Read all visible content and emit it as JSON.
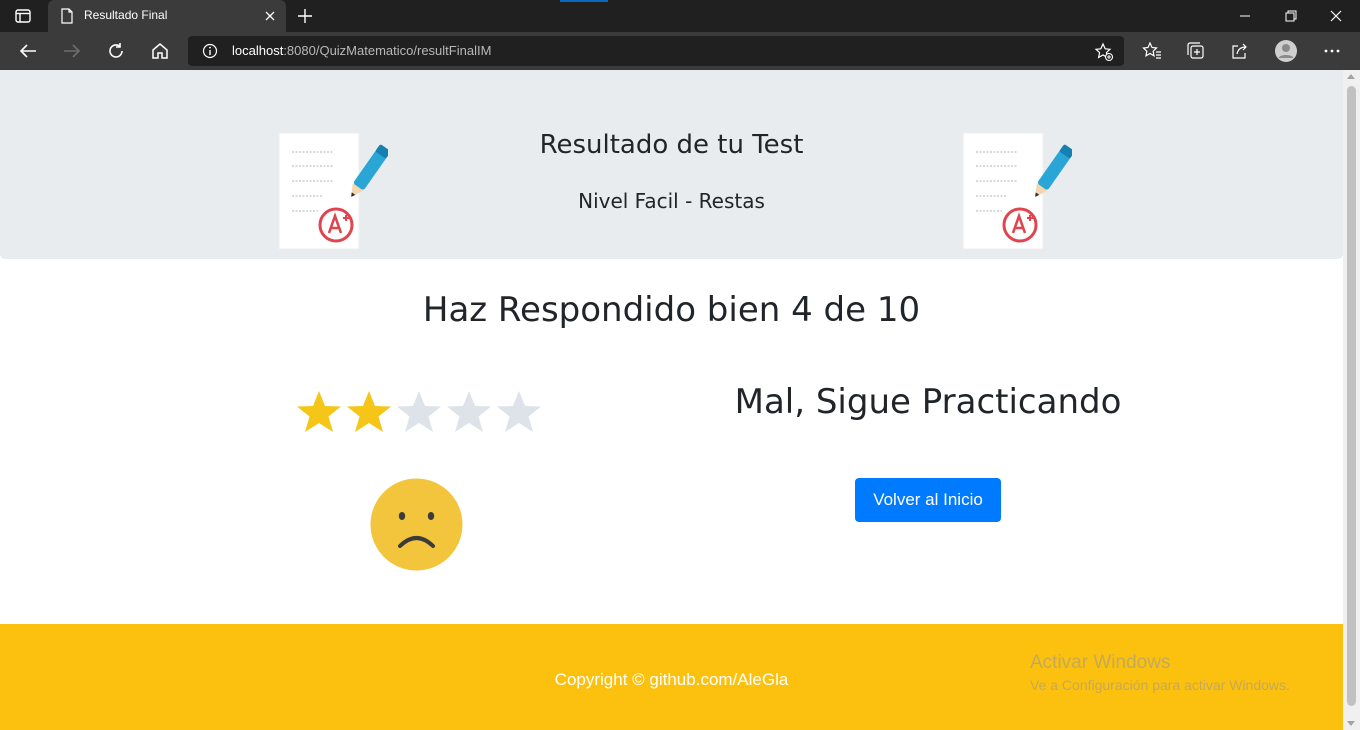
{
  "browser": {
    "tab_title": "Resultado Final",
    "url_host": "localhost",
    "url_rest": ":8080/QuizMatematico/resultFinalIM",
    "icons": [
      "sidebar-icon",
      "page-icon",
      "close-icon",
      "plus-icon",
      "minimize-icon",
      "maximize-icon",
      "close-window-icon",
      "back-icon",
      "forward-icon",
      "refresh-icon",
      "home-icon",
      "info-icon",
      "add-favorite-icon",
      "favorites-icon",
      "collections-icon",
      "share-icon",
      "profile-icon",
      "more-icon"
    ]
  },
  "header": {
    "title": "Resultado de tu Test",
    "subtitle": "Nivel Facil - Restas",
    "background": "#e9ecef"
  },
  "result": {
    "score_text": "Haz Respondido bien 4 de 10",
    "rating": {
      "filled": 2,
      "total": 5
    },
    "star_color": "#f5c518",
    "star_empty_color": "#dde3e9",
    "face_icon": "sad-face-icon",
    "verdict": "Mal, Sigue Practicando"
  },
  "actions": {
    "home_button_label": "Volver al Inicio",
    "button_color": "#007bff"
  },
  "footer": {
    "copyright": "Copyright © github.com/AleGla",
    "background": "#fcc10f"
  },
  "os_watermark": {
    "title": "Activar Windows",
    "subtitle": "Ve a Configuración para activar Windows."
  }
}
